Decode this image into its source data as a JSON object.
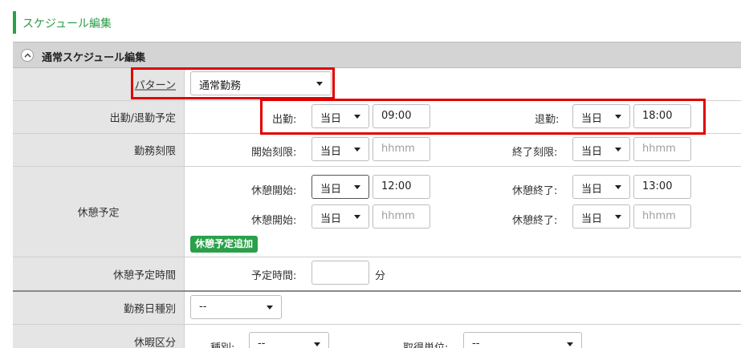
{
  "page": {
    "title": "スケジュール編集"
  },
  "section": {
    "title": "通常スケジュール編集",
    "toggle_icon": "chevron-up-icon"
  },
  "pattern": {
    "label": "パターン",
    "value": "通常勤務"
  },
  "attendance": {
    "label": "出勤/退勤予定",
    "start_label": "出勤:",
    "start_day": "当日",
    "start_time": "09:00",
    "end_label": "退勤:",
    "end_day": "当日",
    "end_time": "18:00"
  },
  "limit": {
    "label": "勤務刻限",
    "start_label": "開始刻限:",
    "start_day": "当日",
    "start_placeholder": "hhmm",
    "end_label": "終了刻限:",
    "end_day": "当日",
    "end_placeholder": "hhmm"
  },
  "breaks": {
    "label": "休憩予定",
    "rows": [
      {
        "start_label": "休憩開始:",
        "start_day": "当日",
        "start_time": "12:00",
        "end_label": "休憩終了:",
        "end_day": "当日",
        "end_time": "13:00"
      },
      {
        "start_label": "休憩開始:",
        "start_day": "当日",
        "start_placeholder": "hhmm",
        "end_label": "休憩終了:",
        "end_day": "当日",
        "end_placeholder": "hhmm"
      }
    ],
    "add_button": "休憩予定追加"
  },
  "break_time": {
    "label": "休憩予定時間",
    "field_label": "予定時間:",
    "unit": "分"
  },
  "work_day_type": {
    "label": "勤務日種別",
    "value": "--"
  },
  "leave": {
    "label": "休暇区分",
    "type_label": "種別:",
    "type_value": "--",
    "unit_label": "取得単位:",
    "unit_value": "--"
  },
  "colors": {
    "accent": "#2aa04a",
    "highlight": "#e00000",
    "label_bg": "#e5e5e5",
    "header_bg": "#d4d4d4"
  }
}
